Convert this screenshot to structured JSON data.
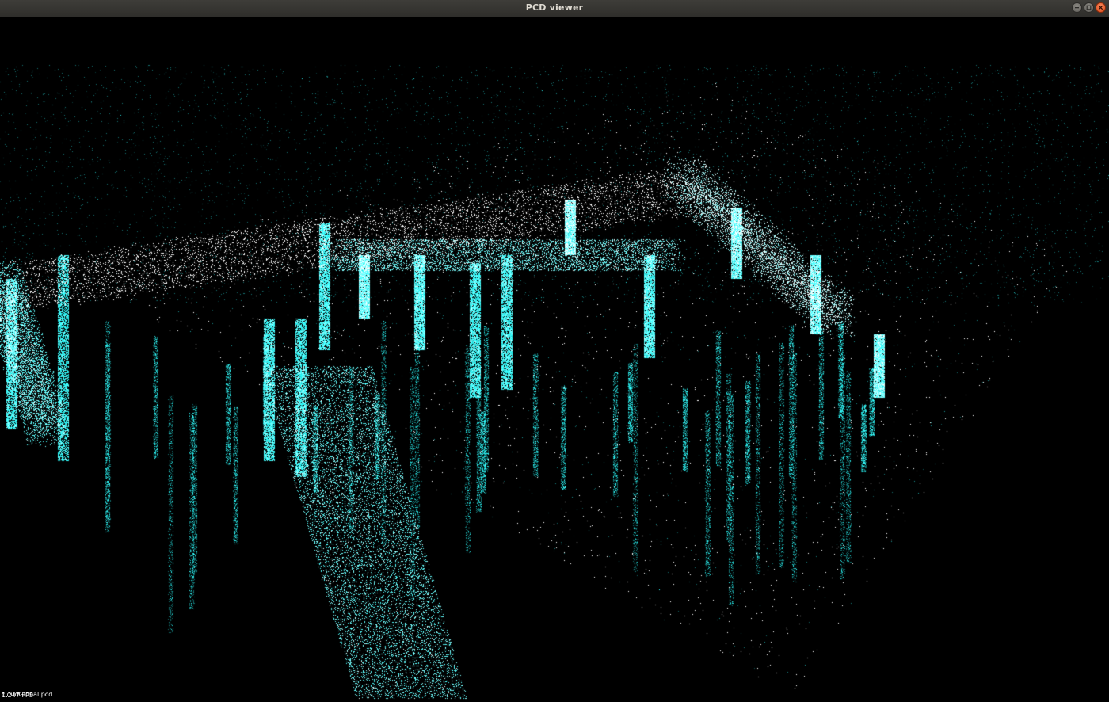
{
  "window": {
    "title": "PCD viewer",
    "controls": {
      "minimize_icon": "minimize-icon",
      "maximize_icon": "maximize-icon",
      "close_icon": "close-icon"
    }
  },
  "viewer": {
    "background_color": "#000000",
    "point_color": "#26e0e0",
    "overlay": {
      "fps": "1.247 FPS",
      "file": "cloudGlobal.pcd"
    }
  }
}
